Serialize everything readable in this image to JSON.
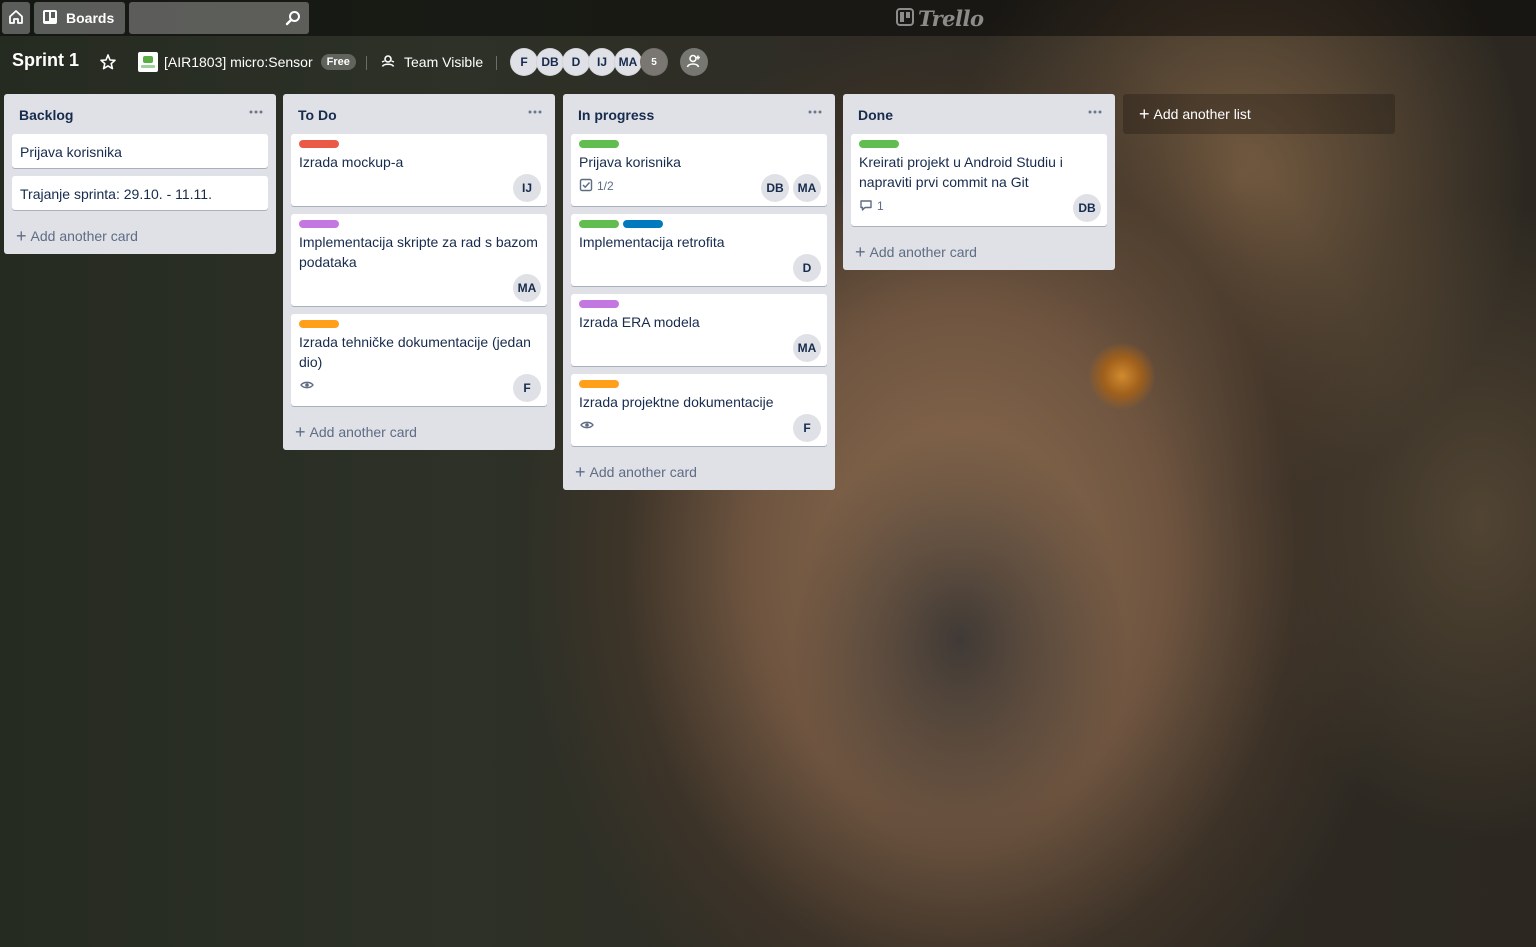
{
  "header": {
    "home_icon": "home-icon",
    "boards_label": "Boards",
    "search": {
      "value": "",
      "placeholder": ""
    },
    "logo_text": "Trello"
  },
  "board": {
    "title": "Sprint 1",
    "team_name": "[AIR1803] micro:Sensor",
    "team_badge": "Free",
    "visibility": "Team Visible",
    "members": [
      "F",
      "DB",
      "D",
      "IJ",
      "MA"
    ],
    "members_more": "5"
  },
  "lists": [
    {
      "title": "Backlog",
      "cards": [
        {
          "title": "Prijava korisnika"
        },
        {
          "title": "Trajanje sprinta: 29.10. - 11.11."
        }
      ],
      "add_card": "Add another card"
    },
    {
      "title": "To Do",
      "cards": [
        {
          "labels": [
            "#eb5a46"
          ],
          "title": "Izrada mockup-a",
          "members": [
            "IJ"
          ]
        },
        {
          "labels": [
            "#c377e0"
          ],
          "title": "Implementacija skripte za rad s bazom podataka",
          "members": [
            "MA"
          ]
        },
        {
          "labels": [
            "#ff9f1a"
          ],
          "title": "Izrada tehničke dokumentacije (jedan dio)",
          "members": [
            "F"
          ],
          "watching": true
        }
      ],
      "add_card": "Add another card"
    },
    {
      "title": "In progress",
      "cards": [
        {
          "labels": [
            "#61bd4f"
          ],
          "title": "Prijava korisnika",
          "checklist": "1/2",
          "members": [
            "DB",
            "MA"
          ]
        },
        {
          "labels": [
            "#61bd4f",
            "#0079bf"
          ],
          "title": "Implementacija retrofita",
          "members": [
            "D"
          ]
        },
        {
          "labels": [
            "#c377e0"
          ],
          "title": "Izrada ERA modela",
          "members": [
            "MA"
          ]
        },
        {
          "labels": [
            "#ff9f1a"
          ],
          "title": "Izrada projektne dokumentacije",
          "members": [
            "F"
          ],
          "watching": true
        }
      ],
      "add_card": "Add another card"
    },
    {
      "title": "Done",
      "cards": [
        {
          "labels": [
            "#61bd4f"
          ],
          "title": "Kreirati projekt u Android Studiu i napraviti prvi commit na Git",
          "comments": "1",
          "members": [
            "DB"
          ]
        }
      ],
      "add_card": "Add another card"
    }
  ],
  "add_list_label": "Add another list"
}
